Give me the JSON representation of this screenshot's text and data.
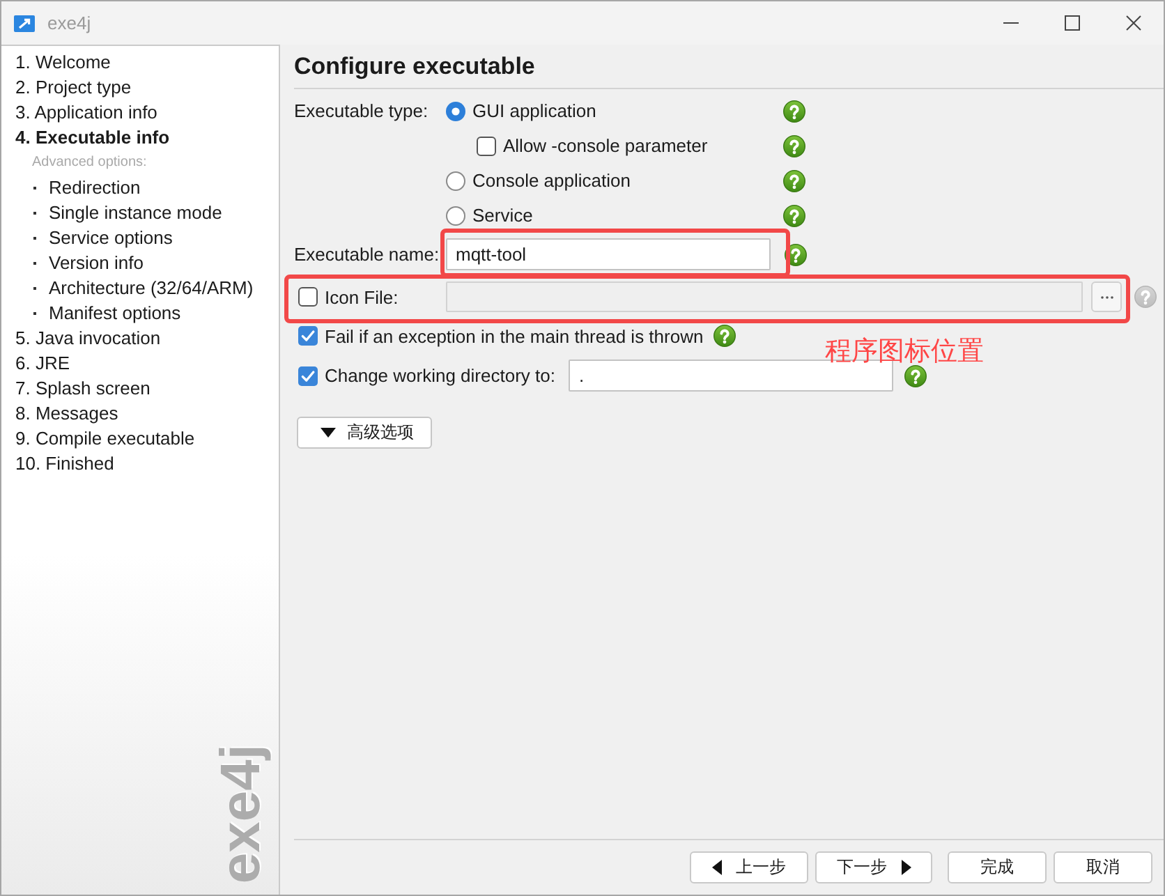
{
  "window": {
    "title": "exe4j"
  },
  "sidebar": {
    "items": [
      {
        "label": "1. Welcome",
        "selected": false
      },
      {
        "label": "2. Project type",
        "selected": false
      },
      {
        "label": "3. Application info",
        "selected": false
      },
      {
        "label": "4. Executable info",
        "selected": true,
        "section_label": "Advanced options:",
        "children": [
          {
            "label": "Redirection",
            "selected": false
          },
          {
            "label": "Single instance mode",
            "selected": false
          },
          {
            "label": "Service options",
            "selected": false
          },
          {
            "label": "Version info",
            "selected": false
          },
          {
            "label": "Architecture (32/64/ARM)",
            "selected": false
          },
          {
            "label": "Manifest options",
            "selected": false
          }
        ]
      },
      {
        "label": "5. Java invocation",
        "selected": false
      },
      {
        "label": "6. JRE",
        "selected": false
      },
      {
        "label": "7. Splash screen",
        "selected": false
      },
      {
        "label": "8. Messages",
        "selected": false
      },
      {
        "label": "9. Compile executable",
        "selected": false
      },
      {
        "label": "10. Finished",
        "selected": false
      }
    ],
    "brand": "exe4j"
  },
  "page": {
    "title": "Configure executable",
    "executable_type": {
      "label": "Executable type:",
      "options": [
        {
          "label": "GUI application",
          "selected": true,
          "sub_option": {
            "label": "Allow -console parameter",
            "checked": false
          }
        },
        {
          "label": "Console application",
          "selected": false
        },
        {
          "label": "Service",
          "selected": false
        }
      ]
    },
    "executable_name": {
      "label": "Executable name:",
      "value": "mqtt-tool",
      "highlighted": true
    },
    "icon_file": {
      "label": "Icon File:",
      "checked": false,
      "disabled": true,
      "highlighted": true
    },
    "fail_on_exception": {
      "label": "Fail if an exception in the main thread is thrown",
      "checked": true
    },
    "working_directory": {
      "label": "Change working directory to:",
      "checked": true,
      "value": "."
    },
    "advanced_button": {
      "label": "高级选项",
      "expanded": false
    },
    "annotation": {
      "text": "程序图标位置"
    }
  },
  "footer": {
    "buttons": [
      {
        "kind": "back",
        "label": "上一步"
      },
      {
        "kind": "next",
        "label": "下一步"
      },
      {
        "kind": "finish",
        "label": "完成"
      },
      {
        "kind": "cancel",
        "label": "取消"
      }
    ]
  }
}
